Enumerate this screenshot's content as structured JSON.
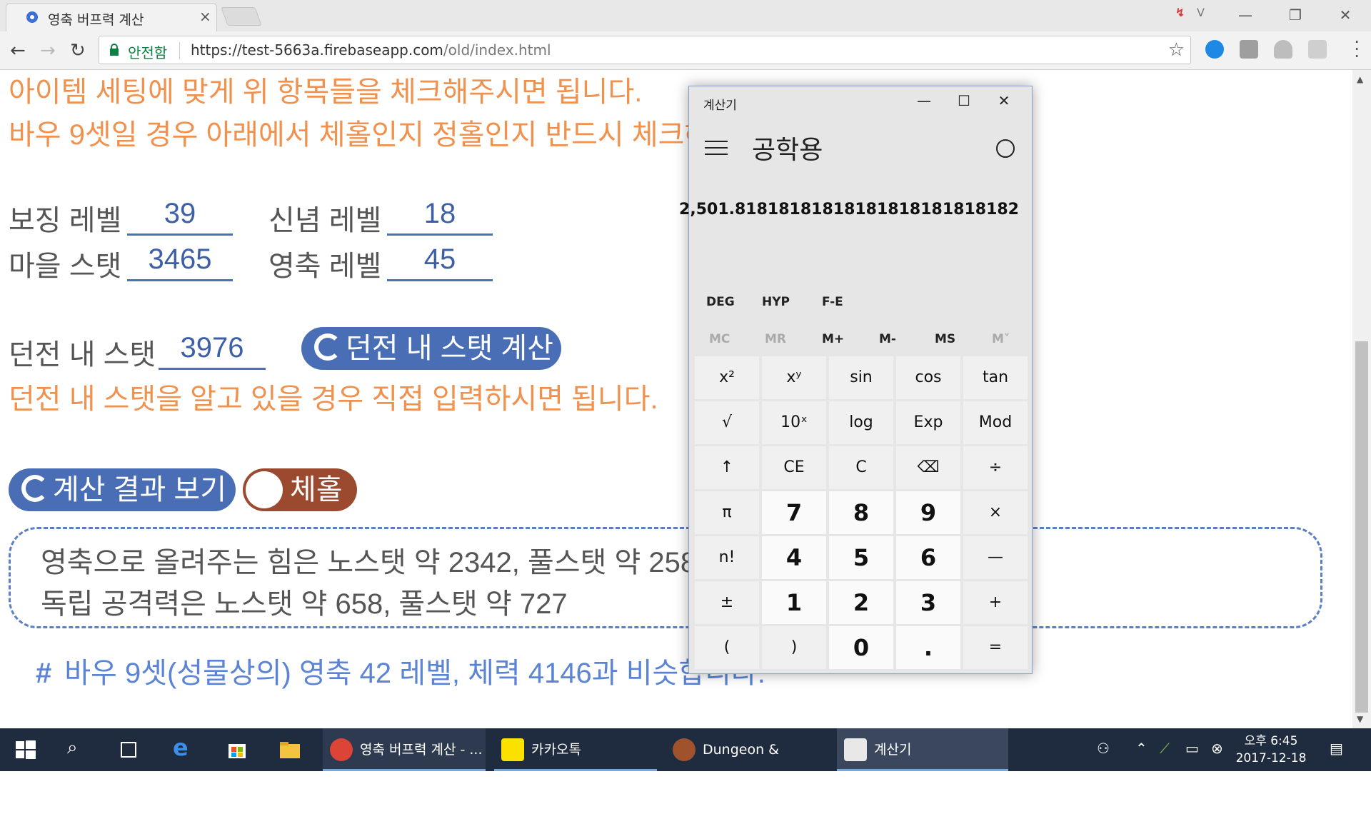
{
  "browser": {
    "tab_title": "영축 버프력 계산",
    "tab_close": "×",
    "secure_label": "안전함",
    "url_host": "https://test-5663a.firebaseapp.com",
    "url_path": "/old/index.html",
    "window_controls": [
      "—",
      "❐",
      "✕"
    ]
  },
  "page": {
    "intro_line1": "아이템 세팅에 맞게 위 항목들을 체크해주시면 됩니다.",
    "intro_line2": "바우 9셋일 경우 아래에서 체홀인지 정홀인지 반드시 체크해",
    "fields": {
      "bojing_label": "보징 레벨",
      "bojing_value": "39",
      "faith_label": "신념 레벨",
      "faith_value": "18",
      "town_label": "마을 스탯",
      "town_value": "3465",
      "yeongchuk_label": "영축 레벨",
      "yeongchuk_value": "45",
      "dungeon_label": "던전 내 스탯",
      "dungeon_value": "3976"
    },
    "dungeon_calc_button": "던전 내 스탯 계산",
    "dungeon_hint": "던전 내 스탯을 알고 있을 경우 직접 입력하시면 됩니다.",
    "result_button": "계산 결과 보기",
    "toggle_label": "체홀",
    "result_line1": "영축으로 올려주는 힘은 노스탯 약 2342, 풀스탯 약 2588",
    "result_line2": "독립 공격력은 노스탯 약 658, 풀스탯 약 727",
    "footnote": "바우 9셋(성물상의) 영축 42 레벨, 체력 4146과 비슷합니다."
  },
  "calculator": {
    "window_title": "계산기",
    "mode": "공학용",
    "display": "2,501.81818181818181818181818182",
    "toggles": [
      "DEG",
      "HYP",
      "F-E"
    ],
    "memory": [
      "MC",
      "MR",
      "M+",
      "M-",
      "MS",
      "M˅"
    ],
    "keys": [
      [
        "x²",
        "xʸ",
        "sin",
        "cos",
        "tan"
      ],
      [
        "√",
        "10ˣ",
        "log",
        "Exp",
        "Mod"
      ],
      [
        "↑",
        "CE",
        "C",
        "⌫",
        "÷"
      ],
      [
        "π",
        "7",
        "8",
        "9",
        "×"
      ],
      [
        "n!",
        "4",
        "5",
        "6",
        "—"
      ],
      [
        "±",
        "1",
        "2",
        "3",
        "+"
      ],
      [
        "(",
        ")",
        "0",
        ".",
        "="
      ]
    ]
  },
  "taskbar": {
    "apps": [
      "영축 버프력 계산 - ...",
      "카카오톡",
      "Dungeon & Fighter",
      "계산기"
    ],
    "clock_time": "오후 6:45",
    "clock_date": "2017-12-18"
  },
  "colors": {
    "accent_blue": "#4a6eb5",
    "orange_text": "#f0914e",
    "toggle_brown": "#9b4a2f"
  }
}
